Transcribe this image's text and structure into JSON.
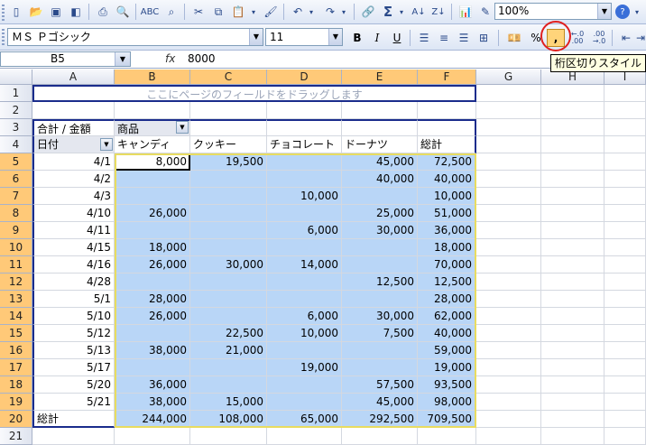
{
  "toolbar": {
    "zoom_value": "100%",
    "sigma": "Σ",
    "font_name": "ＭＳ Ｐゴシック",
    "font_size": "11",
    "bold": "B",
    "italic": "I",
    "underline": "U",
    "percent": "%",
    "comma": ",",
    "inc_decimal": "←.0 .00",
    "dec_decimal": ".00 →.0"
  },
  "tooltip": "桁区切りスタイル",
  "formula_bar": {
    "name_box": "B5",
    "fx": "fx",
    "value": "8000"
  },
  "columns": [
    "A",
    "B",
    "C",
    "D",
    "E",
    "F",
    "G",
    "H",
    "I"
  ],
  "rows": [
    "1",
    "2",
    "3",
    "4",
    "5",
    "6",
    "7",
    "8",
    "9",
    "10",
    "11",
    "12",
    "13",
    "14",
    "15",
    "16",
    "17",
    "18",
    "19",
    "20",
    "21"
  ],
  "pivot": {
    "page_drop_hint": "ここにページのフィールドをドラッグします",
    "data_field": "合計 / 金額",
    "column_field": "商品",
    "row_field": "日付",
    "products": [
      "キャンディ",
      "クッキー",
      "チョコレート",
      "ドーナツ"
    ],
    "grand_total_label": "総計",
    "records": [
      {
        "date": "4/1",
        "values": [
          "8,000",
          "19,500",
          "",
          "45,000"
        ],
        "total": "72,500"
      },
      {
        "date": "4/2",
        "values": [
          "",
          "",
          "",
          "40,000"
        ],
        "total": "40,000"
      },
      {
        "date": "4/3",
        "values": [
          "",
          "",
          "10,000",
          ""
        ],
        "total": "10,000"
      },
      {
        "date": "4/10",
        "values": [
          "26,000",
          "",
          "",
          "25,000"
        ],
        "total": "51,000"
      },
      {
        "date": "4/11",
        "values": [
          "",
          "",
          "6,000",
          "30,000"
        ],
        "total": "36,000"
      },
      {
        "date": "4/15",
        "values": [
          "18,000",
          "",
          "",
          ""
        ],
        "total": "18,000"
      },
      {
        "date": "4/16",
        "values": [
          "26,000",
          "30,000",
          "14,000",
          ""
        ],
        "total": "70,000"
      },
      {
        "date": "4/28",
        "values": [
          "",
          "",
          "",
          "12,500"
        ],
        "total": "12,500"
      },
      {
        "date": "5/1",
        "values": [
          "28,000",
          "",
          "",
          ""
        ],
        "total": "28,000"
      },
      {
        "date": "5/10",
        "values": [
          "26,000",
          "",
          "6,000",
          "30,000"
        ],
        "total": "62,000"
      },
      {
        "date": "5/12",
        "values": [
          "",
          "22,500",
          "10,000",
          "7,500"
        ],
        "total": "40,000"
      },
      {
        "date": "5/13",
        "values": [
          "38,000",
          "21,000",
          "",
          ""
        ],
        "total": "59,000"
      },
      {
        "date": "5/17",
        "values": [
          "",
          "",
          "19,000",
          ""
        ],
        "total": "19,000"
      },
      {
        "date": "5/20",
        "values": [
          "36,000",
          "",
          "",
          "57,500"
        ],
        "total": "93,500"
      },
      {
        "date": "5/21",
        "values": [
          "38,000",
          "15,000",
          "",
          "45,000"
        ],
        "total": "98,000"
      }
    ],
    "grand_totals": [
      "244,000",
      "108,000",
      "65,000",
      "292,500"
    ],
    "grand_total_all": "709,500"
  },
  "colors": {
    "selection_fill": "#b9d6f7",
    "header_highlight": "#ffc978",
    "tooltip_bg": "#ffffe1",
    "callout_ring": "#e02020",
    "pivot_border": "#1a2c8c"
  }
}
